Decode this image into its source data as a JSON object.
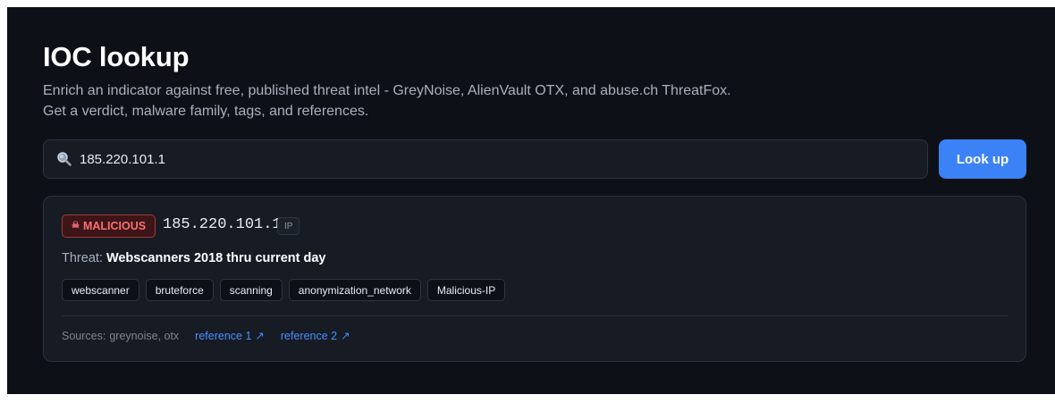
{
  "page": {
    "title": "IOC lookup",
    "subtitle": "Enrich an indicator against free, published threat intel - GreyNoise, AlienVault OTX, and abuse.ch ThreatFox. Get a verdict, malware family, tags, and references."
  },
  "search": {
    "value": "185.220.101.1",
    "icon": "search-icon",
    "button_label": "Look up"
  },
  "result": {
    "verdict": "MALICIOUS",
    "verdict_icon": "☠",
    "indicator": "185.220.101.1",
    "type": "IP",
    "threat_label": "Threat:",
    "threat_name": "Webscanners 2018 thru current day",
    "tags": [
      "webscanner",
      "bruteforce",
      "scanning",
      "anonymization_network",
      "Malicious-IP"
    ],
    "sources_label": "Sources:",
    "sources": "greynoise, otx",
    "references": [
      {
        "label": "reference 1",
        "arrow": "↗"
      },
      {
        "label": "reference 2",
        "arrow": "↗"
      }
    ]
  },
  "colors": {
    "background": "#0d1117",
    "card": "#161b24",
    "accent": "#3b82f6",
    "malicious": "#f87171",
    "link": "#4c8dff"
  }
}
